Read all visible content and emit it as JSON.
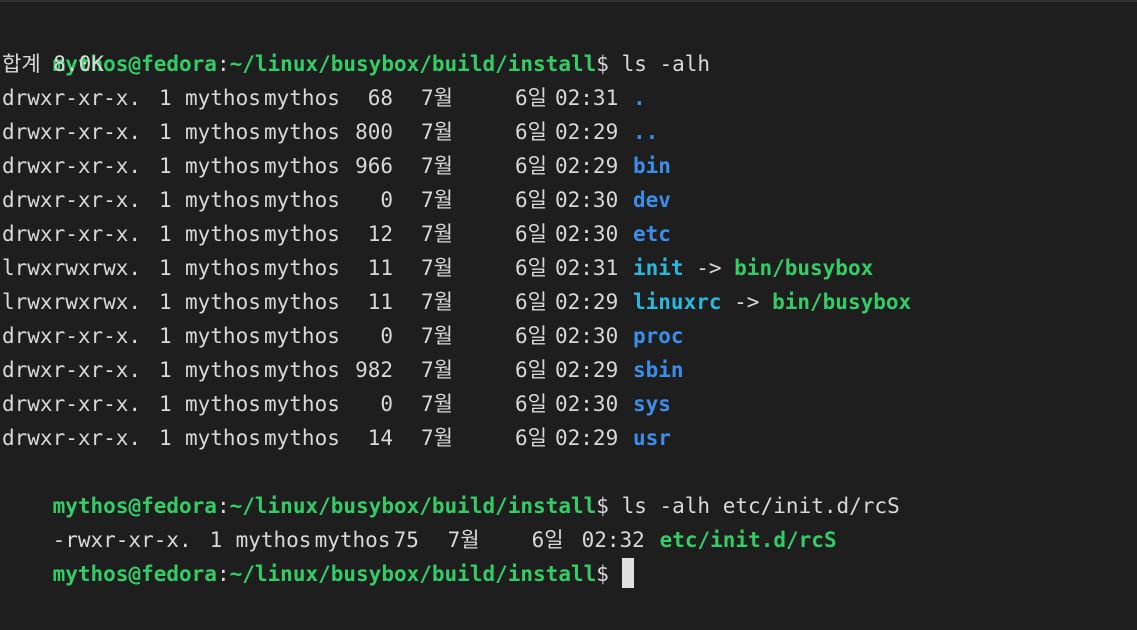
{
  "prompt": {
    "user_host": "mythos@fedora",
    "colon": ":",
    "path": "~/linux/busybox/build/install",
    "dollar": "$"
  },
  "commands": {
    "first": " ls -alh",
    "second": " ls -alh etc/init.d/rcS"
  },
  "total_line": "합계 8.0K",
  "listing": [
    {
      "perm": "drwxr-xr-x.",
      "links": "1",
      "user": "mythos",
      "group": "mythos",
      "size": "68",
      "month": "7월",
      "day": "6일",
      "time": "02:31",
      "name": ".",
      "type": "dir"
    },
    {
      "perm": "drwxr-xr-x.",
      "links": "1",
      "user": "mythos",
      "group": "mythos",
      "size": "800",
      "month": "7월",
      "day": "6일",
      "time": "02:29",
      "name": "..",
      "type": "dir"
    },
    {
      "perm": "drwxr-xr-x.",
      "links": "1",
      "user": "mythos",
      "group": "mythos",
      "size": "966",
      "month": "7월",
      "day": "6일",
      "time": "02:29",
      "name": "bin",
      "type": "dir"
    },
    {
      "perm": "drwxr-xr-x.",
      "links": "1",
      "user": "mythos",
      "group": "mythos",
      "size": "0",
      "month": "7월",
      "day": "6일",
      "time": "02:30",
      "name": "dev",
      "type": "dir"
    },
    {
      "perm": "drwxr-xr-x.",
      "links": "1",
      "user": "mythos",
      "group": "mythos",
      "size": "12",
      "month": "7월",
      "day": "6일",
      "time": "02:30",
      "name": "etc",
      "type": "dir"
    },
    {
      "perm": "lrwxrwxrwx.",
      "links": "1",
      "user": "mythos",
      "group": "mythos",
      "size": "11",
      "month": "7월",
      "day": "6일",
      "time": "02:31",
      "name": "init",
      "type": "link",
      "arrow": " -> ",
      "target": "bin/busybox"
    },
    {
      "perm": "lrwxrwxrwx.",
      "links": "1",
      "user": "mythos",
      "group": "mythos",
      "size": "11",
      "month": "7월",
      "day": "6일",
      "time": "02:29",
      "name": "linuxrc",
      "type": "link",
      "arrow": " -> ",
      "target": "bin/busybox"
    },
    {
      "perm": "drwxr-xr-x.",
      "links": "1",
      "user": "mythos",
      "group": "mythos",
      "size": "0",
      "month": "7월",
      "day": "6일",
      "time": "02:30",
      "name": "proc",
      "type": "dir"
    },
    {
      "perm": "drwxr-xr-x.",
      "links": "1",
      "user": "mythos",
      "group": "mythos",
      "size": "982",
      "month": "7월",
      "day": "6일",
      "time": "02:29",
      "name": "sbin",
      "type": "dir"
    },
    {
      "perm": "drwxr-xr-x.",
      "links": "1",
      "user": "mythos",
      "group": "mythos",
      "size": "0",
      "month": "7월",
      "day": "6일",
      "time": "02:30",
      "name": "sys",
      "type": "dir"
    },
    {
      "perm": "drwxr-xr-x.",
      "links": "1",
      "user": "mythos",
      "group": "mythos",
      "size": "14",
      "month": "7월",
      "day": "6일",
      "time": "02:29",
      "name": "usr",
      "type": "dir"
    }
  ],
  "rcs": {
    "perm": "-rwxr-xr-x.",
    "links": "1",
    "user": "mythos",
    "group": "mythos",
    "size": "75",
    "month": "7월",
    "day": "6일",
    "time": "02:32",
    "name": "etc/init.d/rcS"
  },
  "colors": {
    "background": "#1e1e1e",
    "prompt": "#33cc66",
    "directory": "#3b8eea",
    "symlink": "#29b8db",
    "executable": "#33cc66",
    "text": "#d8d8d8"
  }
}
